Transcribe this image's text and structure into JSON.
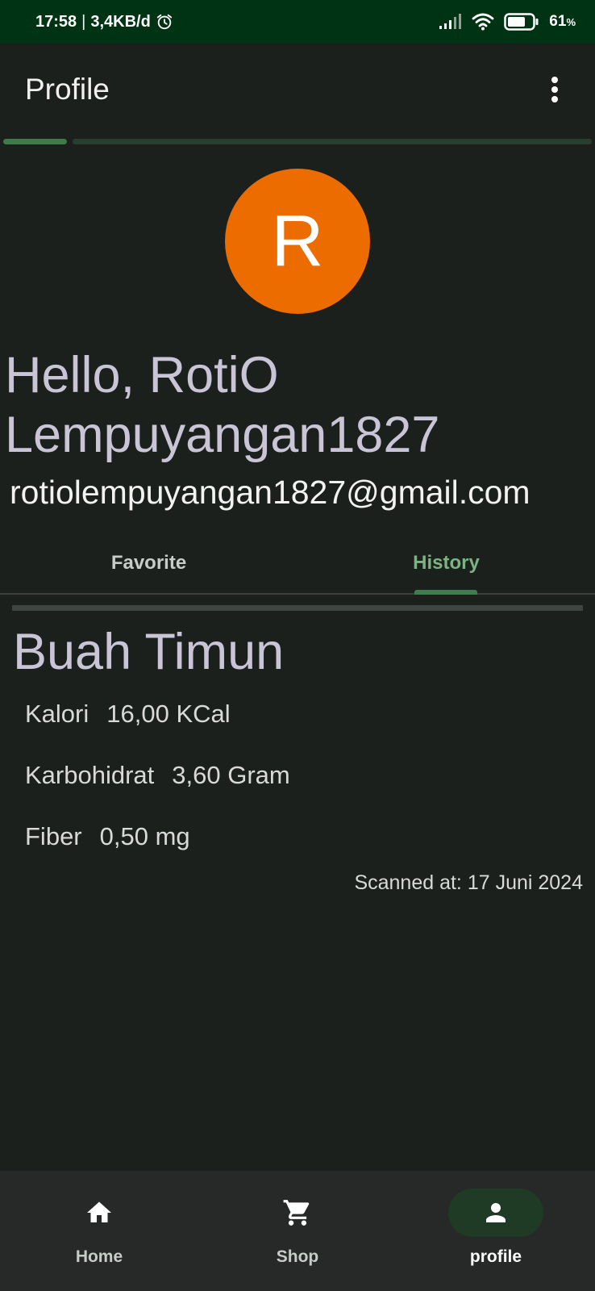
{
  "status_bar": {
    "time": "17:58",
    "separator": "|",
    "net_speed": "3,4KB/d",
    "battery_percent": "61",
    "battery_unit": "%"
  },
  "app_bar": {
    "title": "Profile"
  },
  "profile": {
    "avatar_letter": "R",
    "greeting": "Hello, RotiO Lempuyangan1827",
    "email": "rotiolempuyangan1827@gmail.com"
  },
  "tabs": [
    {
      "label": "Favorite",
      "active": false
    },
    {
      "label": "History",
      "active": true
    }
  ],
  "history_item": {
    "title": "Buah Timun",
    "nutrients": [
      {
        "label": "Kalori",
        "value": "16,00 KCal"
      },
      {
        "label": "Karbohidrat",
        "value": "3,60 Gram"
      },
      {
        "label": "Fiber",
        "value": "0,50 mg"
      }
    ],
    "scanned_at": "Scanned at: 17 Juni 2024"
  },
  "bottom_nav": [
    {
      "label": "Home",
      "icon": "home-icon",
      "active": false
    },
    {
      "label": "Shop",
      "icon": "cart-icon",
      "active": false
    },
    {
      "label": "profile",
      "icon": "person-icon",
      "active": true
    }
  ],
  "colors": {
    "status_bar_bg": "#003314",
    "background": "#1c201d",
    "avatar_bg": "#ec6c00",
    "accent_green": "#7bb382",
    "nav_bg": "#262927"
  }
}
